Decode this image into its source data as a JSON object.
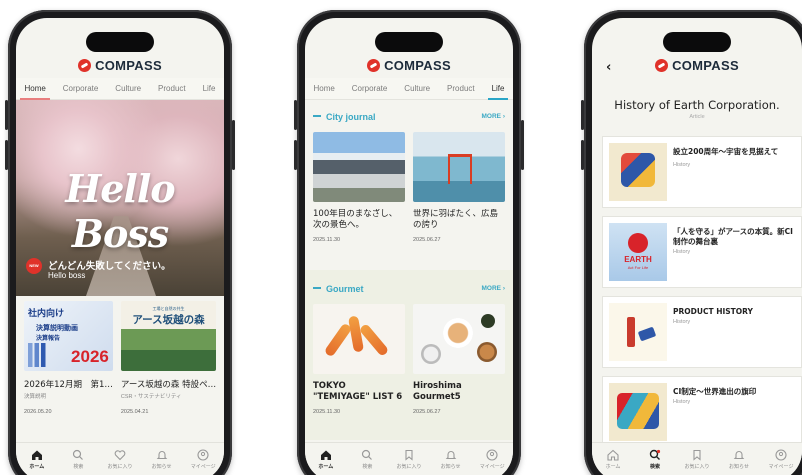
{
  "brand": {
    "name": "COMPASS"
  },
  "tabs": [
    "Home",
    "Corporate",
    "Culture",
    "Product",
    "Life"
  ],
  "bottom_nav": [
    {
      "icon": "home-icon",
      "label": "ホーム"
    },
    {
      "icon": "search-icon",
      "label": "検索"
    },
    {
      "icon": "heart-icon",
      "label": "お気に入り"
    },
    {
      "icon": "bell-icon",
      "label": "お知らせ"
    },
    {
      "icon": "user-icon",
      "label": "マイページ"
    }
  ],
  "bottom_nav_alt": [
    {
      "icon": "home-icon",
      "label": "ホーム"
    },
    {
      "icon": "search-icon",
      "label": "検索"
    },
    {
      "icon": "bookmark-icon",
      "label": "お気に入り"
    },
    {
      "icon": "bell-icon",
      "label": "お知らせ"
    },
    {
      "icon": "user-icon",
      "label": "マイページ"
    }
  ],
  "phone1": {
    "active_tab": "Home",
    "hero": {
      "title": "Hello Boss",
      "badge": "NEW",
      "headline": "どんどん失敗してください。",
      "sub": "Hello boss"
    },
    "cards": [
      {
        "thumb_line1": "社内向け",
        "thumb_line2": "決算説明動画",
        "thumb_line3": "決算報告",
        "thumb_year": "2026",
        "title": "2026年12月期　第1…",
        "category": "決算説明",
        "date": "2026.05.20"
      },
      {
        "thumb_line1": "工場と自然の共生",
        "thumb_line2": "アース坂越の森",
        "title": "アース坂越の森 特設ペ…",
        "category": "CSR・サステナビリティ",
        "date": "2025.04.21"
      }
    ]
  },
  "phone2": {
    "active_tab": "Life",
    "sections": [
      {
        "title": "City journal",
        "more": "MORE",
        "items": [
          {
            "title": "100年目のまなざし、次の景色へ。",
            "date": "2025.11.30"
          },
          {
            "title": "世界に羽ばたく、広島の誇り",
            "date": "2025.06.27"
          }
        ]
      },
      {
        "title": "Gourmet",
        "more": "MORE",
        "items": [
          {
            "title": "TOKYO \"TEMIYAGE\" LIST 6",
            "date": "2025.11.30"
          },
          {
            "title": "Hiroshima Gourmet5",
            "date": "2025.06.27"
          }
        ]
      }
    ]
  },
  "phone3": {
    "title": "History of Earth Corporation.",
    "subtitle": "Article",
    "earth_logo": "EARTH",
    "earth_logo_sub": "Act For Life",
    "articles": [
      {
        "title": "設立200周年〜宇宙を見据えて",
        "tag": "History"
      },
      {
        "title": "「人を守る」がアースの本質。新CI制作の舞台裏",
        "tag": "History"
      },
      {
        "title": "PRODUCT HISTORY",
        "tag": "History"
      },
      {
        "title": "CI制定〜世界進出の旗印",
        "tag": "History"
      }
    ]
  },
  "colors": {
    "accent_blue": "#3aa8c4",
    "accent_red": "#e0322a",
    "frame": "#1b1b1d"
  }
}
